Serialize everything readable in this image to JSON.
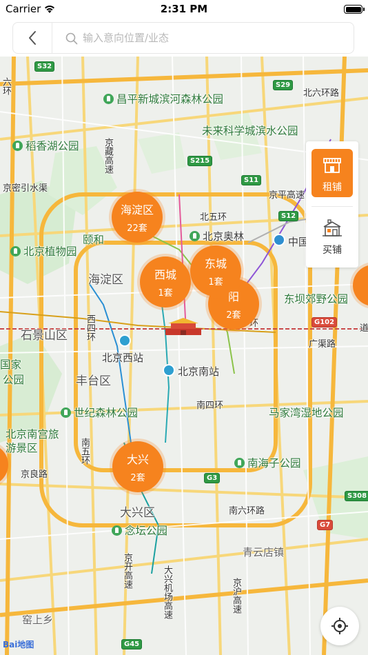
{
  "status_bar": {
    "carrier": "Carrier",
    "time": "2:31 PM"
  },
  "search": {
    "placeholder": "输入意向位置/业态"
  },
  "clusters": [
    {
      "name": "海淀区",
      "count": "22套"
    },
    {
      "name": "西城",
      "count": "1套"
    },
    {
      "name": "东城",
      "count": "1套"
    },
    {
      "name": "阳",
      "count": "2套"
    },
    {
      "name": "大兴",
      "count": "2套"
    }
  ],
  "toggle": {
    "rent_label": "租铺",
    "buy_label": "买铺",
    "active": "租铺"
  },
  "map_labels": {
    "changping_park": "昌平新城滨河森林公园",
    "future_park": "未来科学城滨水公园",
    "daoxiang_park": "稻香湖公园",
    "beijing_botanical": "北京植物园",
    "yihe": "颐和",
    "beijing_olympic": "北京奥林",
    "beiwuhuan": "北五环",
    "haidian_dist": "海淀区",
    "shijingshan_dist": "石景山区",
    "fengtai_dist": "丰台区",
    "daxing_dist": "大兴区",
    "beijing_west": "北京西站",
    "beijing_south": "北京南站",
    "world_forest": "世纪森林公园",
    "beijing_nangong": "北京南宫旅游景区",
    "majiawan": "马家湾湿地公园",
    "nanhaizi": "南海子公园",
    "niantan": "念坛公园",
    "dongba": "东坝郊野公园",
    "guangqu": "广渠路",
    "nansihuan": "南四环",
    "nanliuhuan": "南六环路",
    "beiliuhuan": "北六环路",
    "jingping": "京平高速",
    "jingmi": "京密引水渠",
    "jingliang": "京良路",
    "qingyun": "青云店镇",
    "kaoshang": "窑上乡",
    "zhongguo": "中国",
    "guojia": "国家",
    "gongyuan": "公园",
    "jingzang": "京藏高速",
    "xisihuan": "西四环",
    "nanwuhuan": "南五环",
    "daxing_airport": "大兴机场高速",
    "jingkai": "京开高速",
    "jinghu": "京沪高速",
    "dongsi": "环",
    "liuhuan": "六环",
    "daolu": "道"
  },
  "shields": {
    "s32": "S32",
    "s29": "S29",
    "s215": "S215",
    "s11": "S11",
    "s12": "S12",
    "g102": "G102",
    "g3": "G3",
    "g45": "G45",
    "s308": "S308",
    "g7": "G7"
  },
  "map_provider": "Bai地图"
}
